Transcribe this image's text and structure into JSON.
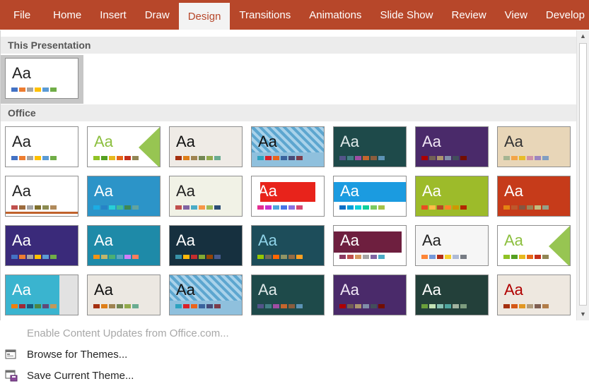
{
  "tabs": [
    "File",
    "Home",
    "Insert",
    "Draw",
    "Design",
    "Transitions",
    "Animations",
    "Slide Show",
    "Review",
    "View",
    "Develop"
  ],
  "active_tab": "Design",
  "sections": {
    "this_presentation": "This Presentation",
    "office": "Office"
  },
  "tile_label": "Aa",
  "menu": {
    "enable_updates": "Enable Content Updates from Office.com...",
    "browse": "Browse for Themes...",
    "save": "Save Current Theme..."
  },
  "colors": {
    "ribbon": "#b7472a",
    "section_header": "#ececec"
  },
  "icons": {
    "browse": "folder-browse-icon",
    "save": "save-theme-icon",
    "scroll_up": "scroll-up-icon",
    "scroll_down": "scroll-down-icon"
  },
  "current_theme": {
    "bg": "#ffffff",
    "fg": "#222222",
    "swatches": [
      "#4472c4",
      "#ed7d31",
      "#a5a5a5",
      "#ffc000",
      "#5b9bd5",
      "#70ad47"
    ]
  },
  "themes": [
    {
      "bg": "#ffffff",
      "fg": "#222222",
      "accent": "none",
      "swatches": [
        "#4472c4",
        "#ed7d31",
        "#a5a5a5",
        "#ffc000",
        "#5b9bd5",
        "#70ad47"
      ]
    },
    {
      "bg": "#ffffff",
      "fg": "#8cbf3f",
      "accent": "facet",
      "swatches": [
        "#90c226",
        "#54a021",
        "#e6b91e",
        "#e76618",
        "#c42f1a",
        "#918655"
      ]
    },
    {
      "bg": "#efebe6",
      "fg": "#111111",
      "accent": "none",
      "swatches": [
        "#a53010",
        "#de7e18",
        "#9f8351",
        "#728653",
        "#92aa4c",
        "#6aac91"
      ]
    },
    {
      "bg": "#8fc0dd",
      "fg": "#111111",
      "accent": "pattern",
      "swatches": [
        "#2da2bf",
        "#da1f28",
        "#eb641b",
        "#39639d",
        "#474b78",
        "#7d3c4a"
      ]
    },
    {
      "bg": "#1e4a4a",
      "fg": "#dfe9e9",
      "accent": "none",
      "swatches": [
        "#53548a",
        "#438086",
        "#a04da3",
        "#c4652d",
        "#8b5d3d",
        "#5c92b5"
      ]
    },
    {
      "bg": "#4a2a6a",
      "fg": "#f0e6f5",
      "accent": "none",
      "swatches": [
        "#ad0101",
        "#726056",
        "#ac956e",
        "#808da9",
        "#424e5b",
        "#730e00"
      ]
    },
    {
      "bg": "#e8d6b8",
      "fg": "#333333",
      "accent": "none",
      "swatches": [
        "#a5b592",
        "#f3a447",
        "#e7bc29",
        "#d092a7",
        "#9c85c0",
        "#809ec2"
      ]
    },
    {
      "bg": "#ffffff",
      "fg": "#222222",
      "accent": "bar",
      "swatches": [
        "#c0504d",
        "#9c6b3d",
        "#a5a5a5",
        "#7f6f2d",
        "#8c8c52",
        "#b08a5b"
      ]
    },
    {
      "bg": "#2c94c8",
      "fg": "#ffffff",
      "accent": "none",
      "swatches": [
        "#1cade4",
        "#2683c6",
        "#27ced7",
        "#42ba97",
        "#3e8853",
        "#62a39f"
      ]
    },
    {
      "bg": "#f1f2e6",
      "fg": "#222222",
      "accent": "none",
      "swatches": [
        "#c0504d",
        "#8064a2",
        "#4bacc6",
        "#f79646",
        "#9bbb59",
        "#2c4d75"
      ]
    },
    {
      "bg": "#ffffff",
      "fg": "#ffffff",
      "accent": "red",
      "swatches": [
        "#e32d91",
        "#c830cc",
        "#4ea6dc",
        "#4775e7",
        "#8971e1",
        "#d54773"
      ]
    },
    {
      "bg": "#ffffff",
      "fg": "#ffffff",
      "accent": "blue",
      "swatches": [
        "#0f6fc6",
        "#009dd9",
        "#0bd0d9",
        "#10cf9b",
        "#7cca62",
        "#a5c249"
      ]
    },
    {
      "bg": "#9dbb2a",
      "fg": "#ffffff",
      "accent": "none",
      "swatches": [
        "#e84c22",
        "#ffbd47",
        "#b64926",
        "#ff8427",
        "#cc9900",
        "#b22600"
      ]
    },
    {
      "bg": "#c63b1a",
      "fg": "#ffffff",
      "accent": "none",
      "swatches": [
        "#e48312",
        "#bd582c",
        "#865640",
        "#9b8357",
        "#c2bc80",
        "#94a088"
      ]
    },
    {
      "bg": "#3a2a7a",
      "fg": "#ffffff",
      "accent": "none",
      "swatches": [
        "#4472c4",
        "#ed7d31",
        "#a5a5a5",
        "#ffc000",
        "#5b9bd5",
        "#70ad47"
      ]
    },
    {
      "bg": "#1e8aa8",
      "fg": "#ffffff",
      "accent": "none",
      "swatches": [
        "#f09415",
        "#c1b56b",
        "#4baf73",
        "#5aa6c0",
        "#d17df9",
        "#fa7e5c"
      ]
    },
    {
      "bg": "#16303f",
      "fg": "#ffffff",
      "accent": "none",
      "swatches": [
        "#3891a7",
        "#feb80a",
        "#c32d2e",
        "#84aa33",
        "#964305",
        "#475a8d"
      ]
    },
    {
      "bg": "#1d4d5a",
      "fg": "#8fd3e8",
      "accent": "none",
      "swatches": [
        "#94c600",
        "#71685a",
        "#ff6700",
        "#909465",
        "#956b43",
        "#fea022"
      ]
    },
    {
      "bg": "#ffffff",
      "fg": "#ffffff",
      "accent": "maroon",
      "swatches": [
        "#8b3a62",
        "#c0504d",
        "#d5975e",
        "#a5a5a5",
        "#8064a2",
        "#4bacc6"
      ]
    },
    {
      "bg": "#f6f6f6",
      "fg": "#222222",
      "accent": "none",
      "swatches": [
        "#fe8637",
        "#7598d9",
        "#b32c16",
        "#f5cd2d",
        "#aebad5",
        "#777c84"
      ]
    },
    {
      "bg": "#ffffff",
      "fg": "#8cbf3f",
      "accent": "facet",
      "swatches": [
        "#90c226",
        "#54a021",
        "#e6b91e",
        "#e76618",
        "#c42f1a",
        "#918655"
      ]
    },
    {
      "bg": "#3ab4cf",
      "fg": "#ffffff",
      "accent": "panel",
      "swatches": [
        "#f07f09",
        "#9f2936",
        "#1b587c",
        "#4e8542",
        "#604878",
        "#c19859"
      ]
    },
    {
      "bg": "#ece8e2",
      "fg": "#111111",
      "accent": "none",
      "swatches": [
        "#a53010",
        "#de7e18",
        "#9f8351",
        "#728653",
        "#92aa4c",
        "#6aac91"
      ]
    },
    {
      "bg": "#8fc0dd",
      "fg": "#111111",
      "accent": "pattern",
      "swatches": [
        "#2da2bf",
        "#da1f28",
        "#eb641b",
        "#39639d",
        "#474b78",
        "#7d3c4a"
      ]
    },
    {
      "bg": "#1e4a4a",
      "fg": "#dfe9e9",
      "accent": "none",
      "swatches": [
        "#53548a",
        "#438086",
        "#a04da3",
        "#c4652d",
        "#8b5d3d",
        "#5c92b5"
      ]
    },
    {
      "bg": "#4a2a6a",
      "fg": "#f0e6f5",
      "accent": "none",
      "swatches": [
        "#ad0101",
        "#726056",
        "#ac956e",
        "#808da9",
        "#424e5b",
        "#730e00"
      ]
    },
    {
      "bg": "#23403a",
      "fg": "#ffffff",
      "accent": "none",
      "swatches": [
        "#6a9f3b",
        "#c3e1b4",
        "#88c2b3",
        "#4fa69f",
        "#a2b29f",
        "#7d9c7f"
      ]
    },
    {
      "bg": "#eee8e0",
      "fg": "#b00000",
      "accent": "none",
      "swatches": [
        "#a5300f",
        "#d55816",
        "#e19825",
        "#b19c7d",
        "#7f5f52",
        "#b27d49"
      ]
    }
  ]
}
